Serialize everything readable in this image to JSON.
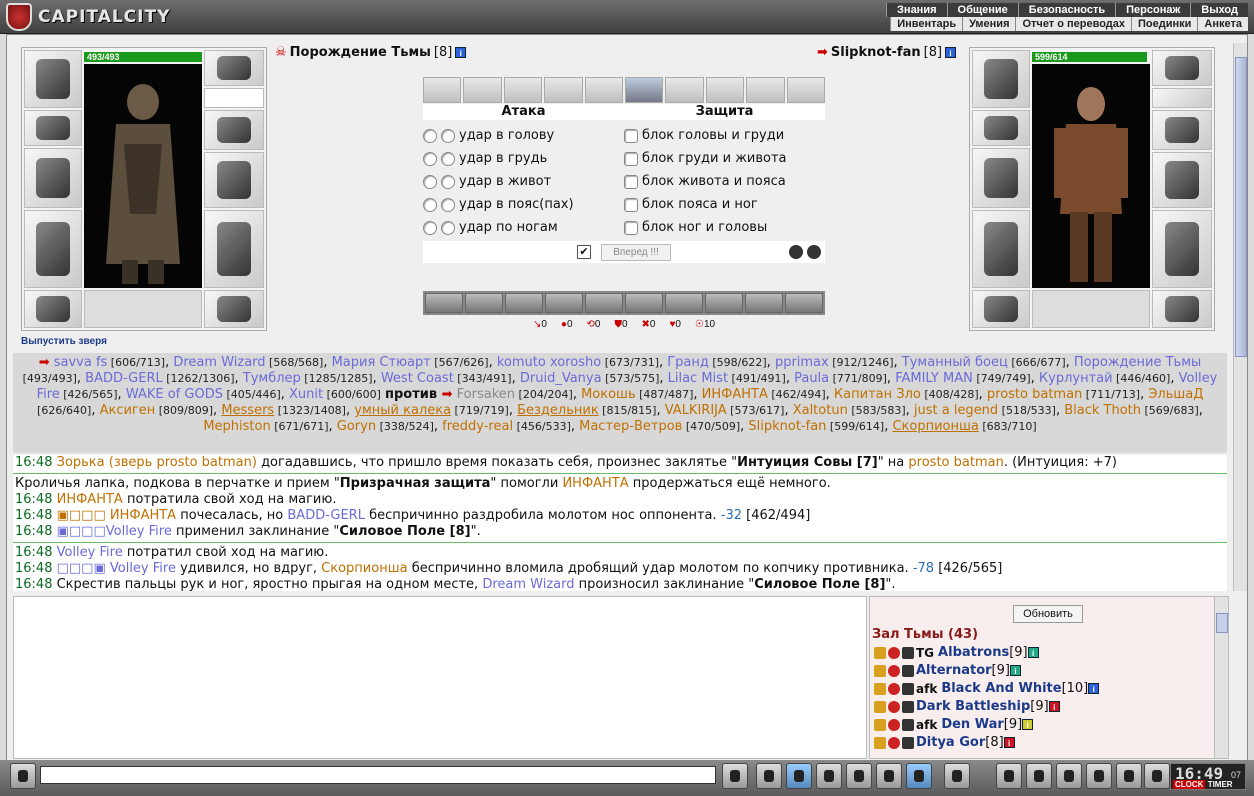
{
  "app": {
    "logo": "CAPITALCITY"
  },
  "nav": {
    "top": [
      "Знания",
      "Общение",
      "Безопасность",
      "Персонаж",
      "Выход"
    ],
    "sub": [
      "Инвентарь",
      "Умения",
      "Отчет о переводах",
      "Поединки",
      "Анкета"
    ]
  },
  "left_fighter": {
    "name": "Порождение Тьмы",
    "level": "[8]",
    "hp": "493/493",
    "hp_fraction": 1.0,
    "release": "Выпустить зверя"
  },
  "right_fighter": {
    "name": "Slipknot-fan",
    "level": "[8]",
    "hp": "599/614",
    "hp_fraction": 0.976
  },
  "combat": {
    "attack_header": "Атака",
    "defense_header": "Защита",
    "attacks": [
      "удар в голову",
      "удар в грудь",
      "удар в живот",
      "удар в пояс(пах)",
      "удар по ногам"
    ],
    "blocks": [
      "блок головы и груди",
      "блок груди и живота",
      "блок живота и пояса",
      "блок пояса и ног",
      "блок ног и головы"
    ],
    "go_button": "Вперед !!!",
    "go_checked": "✔",
    "stats": [
      {
        "icon": "↘",
        "val": "0"
      },
      {
        "icon": "●",
        "val": "0"
      },
      {
        "icon": "⟲",
        "val": "0"
      },
      {
        "icon": "⛊",
        "val": "0"
      },
      {
        "icon": "✖",
        "val": "0"
      },
      {
        "icon": "♥",
        "val": "0"
      },
      {
        "icon": "☉",
        "val": "10"
      }
    ]
  },
  "battlers": {
    "team1": [
      {
        "n": "savva fs",
        "h": "[606/713]"
      },
      {
        "n": "Dream Wizard",
        "h": "[568/568]"
      },
      {
        "n": "Мария Стюарт",
        "h": "[567/626]"
      },
      {
        "n": "komuto xorosho",
        "h": "[673/731]"
      },
      {
        "n": "Гранд",
        "h": "[598/622]"
      },
      {
        "n": "pprimax",
        "h": "[912/1246]"
      },
      {
        "n": "Туманный боец",
        "h": "[666/677]"
      },
      {
        "n": "Порождение Тьмы",
        "h": "[493/493]"
      },
      {
        "n": "BADD-GERL",
        "h": "[1262/1306]"
      },
      {
        "n": "Тумблер",
        "h": "[1285/1285]"
      },
      {
        "n": "West Coast",
        "h": "[343/491]"
      },
      {
        "n": "Druid_Vanya",
        "h": "[573/575]"
      },
      {
        "n": "Lilac Mist",
        "h": "[491/491]"
      },
      {
        "n": "Paula",
        "h": "[771/809]"
      },
      {
        "n": "FAMILY MAN",
        "h": "[749/749]"
      },
      {
        "n": "Курлунтай",
        "h": "[446/460]"
      },
      {
        "n": "Volley Fire",
        "h": "[426/565]"
      },
      {
        "n": "WAKE of GODS",
        "h": "[405/446]"
      },
      {
        "n": "Xunit",
        "h": "[600/600]"
      }
    ],
    "vs": "против",
    "team2_first": {
      "n": "Forsaken",
      "h": "[204/204]"
    },
    "team2": [
      {
        "n": "Мокошь",
        "h": "[487/487]",
        "u": false
      },
      {
        "n": "ИНФАНТА",
        "h": "[462/494]",
        "u": false
      },
      {
        "n": "Капитан Зло",
        "h": "[408/428]",
        "u": false
      },
      {
        "n": "prosto batman",
        "h": "[711/713]",
        "u": false
      },
      {
        "n": "ЭльшаД",
        "h": "[626/640]",
        "u": false
      },
      {
        "n": "Аксиген",
        "h": "[809/809]",
        "u": false
      },
      {
        "n": "Messers",
        "h": "[1323/1408]",
        "u": true
      },
      {
        "n": "умный калека",
        "h": "[719/719]",
        "u": true
      },
      {
        "n": "Бездельник",
        "h": "[815/815]",
        "u": true
      },
      {
        "n": "VALKIRIJA",
        "h": "[573/617]",
        "u": false
      },
      {
        "n": "Xaltotun",
        "h": "[583/583]",
        "u": false
      },
      {
        "n": "just a legend",
        "h": "[518/533]",
        "u": false
      },
      {
        "n": "Black Thoth",
        "h": "[569/683]",
        "u": false
      },
      {
        "n": "Mephiston",
        "h": "[671/671]",
        "u": false
      },
      {
        "n": "Goryn",
        "h": "[338/524]",
        "u": false
      },
      {
        "n": "freddy-real",
        "h": "[456/533]",
        "u": false
      },
      {
        "n": "Мастер-Ветров",
        "h": "[470/509]",
        "u": false
      },
      {
        "n": "Slipknot-fan",
        "h": "[599/614]",
        "u": false
      },
      {
        "n": "Скорпионша",
        "h": "[683/710]",
        "u": true
      }
    ]
  },
  "log": [
    {
      "t": "16:48",
      "html": "<span class='co'>Зорька (зверь prosto batman)</span> догадавшись, что пришло время показать себя, произнес заклятье \"<b>Интуиция Совы [7]</b>\" на <span class='co'>prosto batman</span>. (Интуиция: +7)",
      "sep": true
    },
    {
      "t": "",
      "html": "Кроличья лапка, подкова в перчатке и прием \"<b>Призрачная защита</b>\" помогли <span class='co'>ИНФАНТА</span> продержаться ещё немного."
    },
    {
      "t": "16:48",
      "html": "<span class='co'>ИНФАНТА</span> потратила свой ход на магию."
    },
    {
      "t": "16:48",
      "html": "<span class='co'>▣□□□ ИНФАНТА</span> почесалась, но <span class='cb'>BADD-GERL</span> беспричинно раздробила молотом нос оппонента. <span class='dm'>-32</span> [462/494]"
    },
    {
      "t": "16:48",
      "html": "<span class='cb'>▣□□□Volley Fire</span> применил заклинание \"<b>Силовое Поле [8]</b>\".",
      "sep": true
    },
    {
      "t": "16:48",
      "html": "<span class='cb'>Volley Fire</span> потратил свой ход на магию."
    },
    {
      "t": "16:48",
      "html": "<span class='cb'>□□□▣ Volley Fire</span> удивился, но вдруг, <span class='co'>Скорпионша</span> беспричинно вломила дробящий удар молотом по копчику противника. <span class='dm'>-78</span> [426/565]"
    },
    {
      "t": "16:48",
      "html": "Скрестив пальцы рук и ног, яростно прыгая на одном месте, <span class='cb'>Dream Wizard</span> произносил заклинание \"<b>Силовое Поле [8]</b>\"."
    }
  ],
  "online": {
    "refresh": "Обновить",
    "hall": "Зал Тьмы (43)",
    "users": [
      {
        "prefix": "TG",
        "name": "Albatrons",
        "lvl": "[9]",
        "info": "grn"
      },
      {
        "prefix": "",
        "name": "Alternator",
        "lvl": "[9]",
        "info": "grn"
      },
      {
        "prefix": "afk",
        "name": "Black And White",
        "lvl": "[10]",
        "info": "ib"
      },
      {
        "prefix": "",
        "name": "Dark Battleship",
        "lvl": "[9]",
        "info": "red"
      },
      {
        "prefix": "afk",
        "name": "Den War",
        "lvl": "[9]",
        "info": "yel"
      },
      {
        "prefix": "",
        "name": "Ditya Gor",
        "lvl": "[8]",
        "info": "red"
      }
    ]
  },
  "clock": {
    "time": "16:49",
    "sec": "07",
    "label1": "CLOCK",
    "label2": "TIMER"
  }
}
